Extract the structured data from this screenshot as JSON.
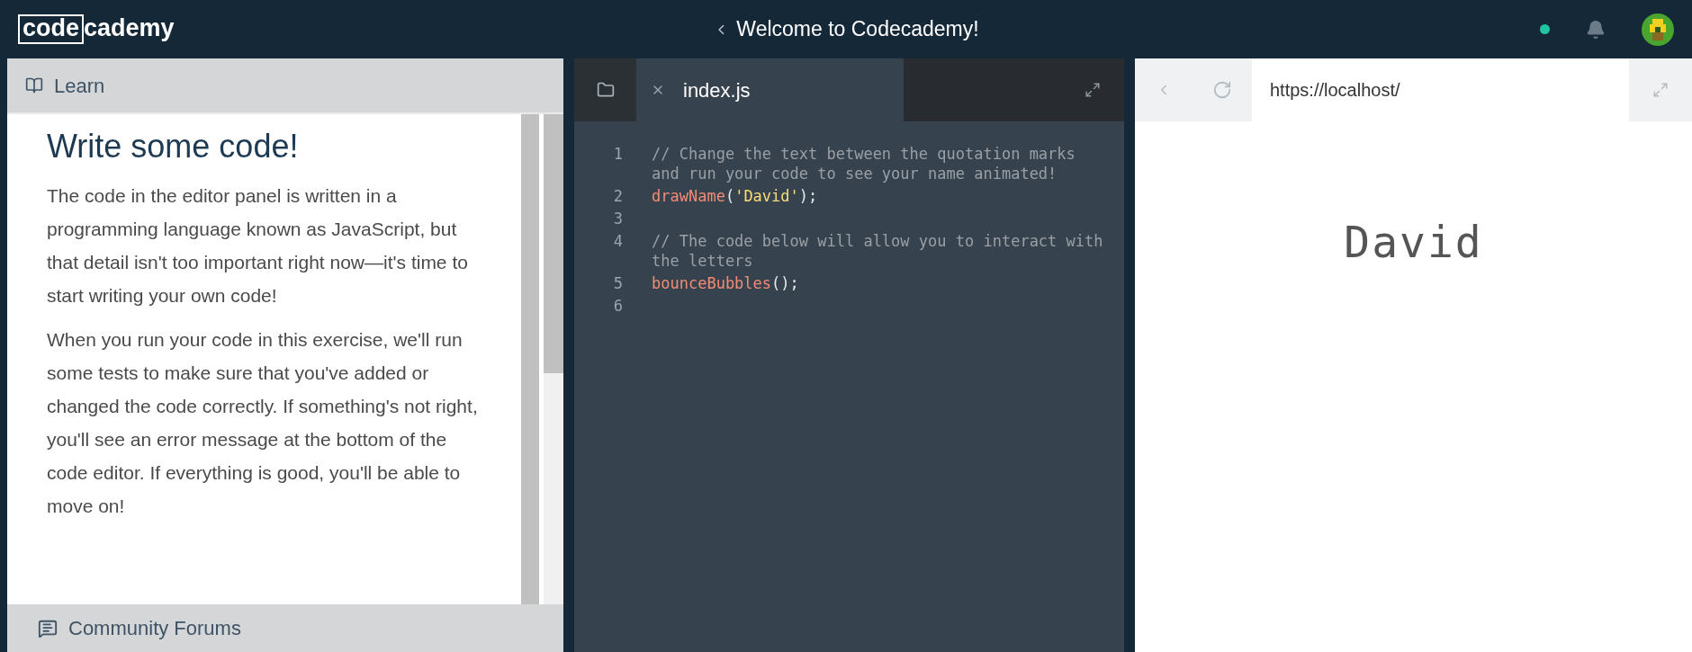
{
  "header": {
    "logo": {
      "boxed": "code",
      "rest": "cademy"
    },
    "title": "Welcome to Codecademy!"
  },
  "learn_panel": {
    "tab": "Learn",
    "heading": "Write some code!",
    "paragraphs": [
      "The code in the editor panel is written in a programming language known as JavaScript, but that detail isn't too important right now—it's time to start writing your own code!",
      "When you run your code in this exercise, we'll run some tests to make sure that you've added or changed the code correctly. If something's not right, you'll see an error message at the bottom of the code editor. If everything is good, you'll be able to move on!"
    ],
    "footer_tab": "Community Forums"
  },
  "editor": {
    "tabs": [
      {
        "label": "index.js",
        "selected": true
      }
    ],
    "lines": [
      {
        "number": "1",
        "tokens": [
          {
            "kind": "comment",
            "text": "// Change the text between the quotation marks and run your code to see your name animated!"
          }
        ]
      },
      {
        "number": "2",
        "tokens": [
          {
            "kind": "function",
            "text": "drawName"
          },
          {
            "kind": "punct",
            "text": "("
          },
          {
            "kind": "string",
            "text": "'David'"
          },
          {
            "kind": "punct",
            "text": ");"
          }
        ]
      },
      {
        "number": "3"
      },
      {
        "number": "4",
        "tokens": [
          {
            "kind": "comment",
            "text": "// The code below will allow you to interact with the letters"
          }
        ]
      },
      {
        "number": "5",
        "tokens": [
          {
            "kind": "function",
            "text": "bounceBubbles"
          },
          {
            "kind": "punct",
            "text": "();"
          }
        ]
      },
      {
        "number": "6"
      }
    ]
  },
  "browser": {
    "url": "https://localhost/",
    "preview_text": "David"
  }
}
